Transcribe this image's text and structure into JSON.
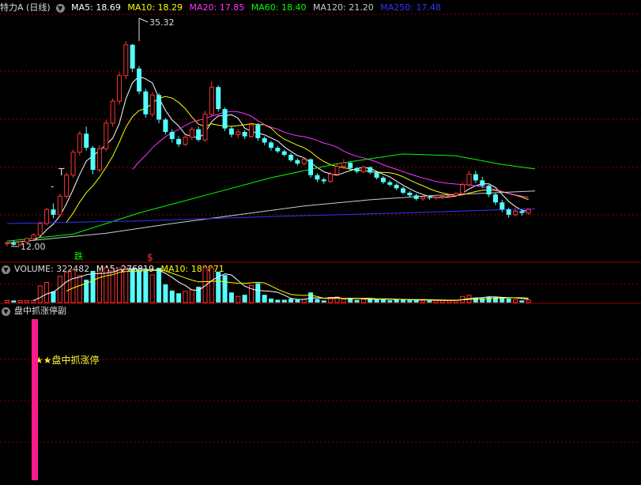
{
  "header": {
    "title": "特力A (日线)",
    "ma": [
      {
        "label": "MA5: 18.69",
        "color": "#ffffff"
      },
      {
        "label": "MA10: 18.29",
        "color": "#ffff00"
      },
      {
        "label": "MA20: 17.85",
        "color": "#ff33ff"
      },
      {
        "label": "MA60: 18.40",
        "color": "#00ff00"
      },
      {
        "label": "MA120: 21.20",
        "color": "#cccccc"
      },
      {
        "label": "MA250: 17.48",
        "color": "#3333ff"
      }
    ]
  },
  "volume_header": {
    "title": "VOLUME: 322482",
    "ma5": "MA5: 276819",
    "ma10": "MA10: 180871"
  },
  "indicator_header": {
    "title": "盘中抓涨停副"
  },
  "signal_label": "★★盘中抓涨停",
  "annotations": {
    "high": "35.32",
    "low": "12.00",
    "die": "跌",
    "s": "$"
  },
  "colors": {
    "up": "#ff3333",
    "down": "#54ffff",
    "grid": "#8b0000",
    "signal_bar": "#ff1a8c"
  },
  "chart_data": {
    "type": "candlestick",
    "high_marker": 35.32,
    "low_marker": 12.0,
    "ma_latest": {
      "MA5": 18.69,
      "MA10": 18.29,
      "MA20": 17.85,
      "MA60": 18.4,
      "MA120": 21.2,
      "MA250": 17.48
    },
    "volume_latest": 322482,
    "volume_ma5": 276819,
    "volume_ma10": 180871,
    "indicator": "盘中抓涨停副",
    "signal_text": "★★盘中抓涨停"
  }
}
